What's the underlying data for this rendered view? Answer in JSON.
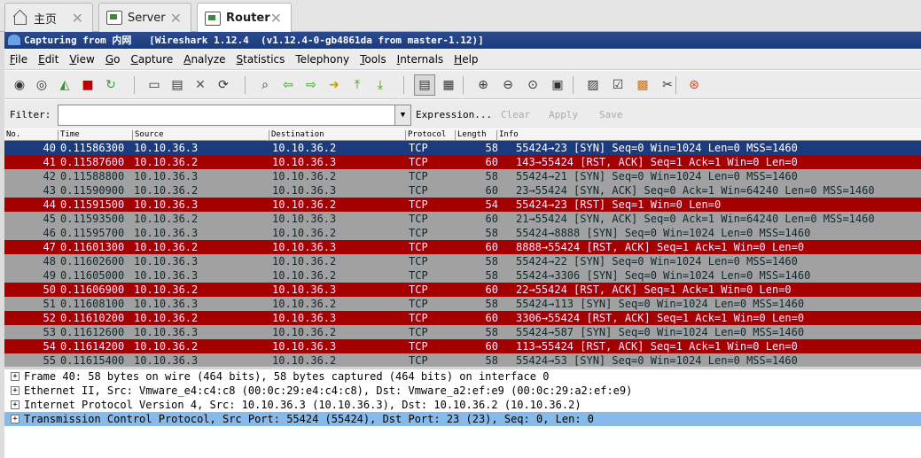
{
  "tabs": [
    {
      "label": "主页",
      "icon": "home-icon"
    },
    {
      "label": "Server",
      "icon": "vm-icon"
    },
    {
      "label": "Router",
      "icon": "vm-icon",
      "active": true
    }
  ],
  "window": {
    "title": "Capturing from 内网   [Wireshark 1.12.4  (v1.12.4-0-gb4861da from master-1.12)]"
  },
  "menu": [
    {
      "u": "F",
      "rest": "ile"
    },
    {
      "u": "E",
      "rest": "dit"
    },
    {
      "u": "V",
      "rest": "iew"
    },
    {
      "u": "G",
      "rest": "o"
    },
    {
      "u": "C",
      "rest": "apture"
    },
    {
      "u": "A",
      "rest": "nalyze"
    },
    {
      "u": "S",
      "rest": "tatistics"
    },
    {
      "u": "",
      "rest": "Telephony"
    },
    {
      "u": "T",
      "rest": "ools"
    },
    {
      "u": "I",
      "rest": "nternals"
    },
    {
      "u": "H",
      "rest": "elp"
    }
  ],
  "toolbar": {
    "icons": [
      "interface-list-icon",
      "capture-options-icon",
      "start-capture-icon",
      "stop-capture-icon",
      "restart-capture-icon",
      "open-file-icon",
      "save-file-icon",
      "close-file-icon",
      "reload-icon",
      "find-packet-icon",
      "go-back-icon",
      "go-forward-icon",
      "go-to-packet-icon",
      "go-first-icon",
      "go-last-icon",
      "colorize-icon",
      "auto-scroll-icon",
      "zoom-in-icon",
      "zoom-out-icon",
      "normal-size-icon",
      "resize-columns-icon",
      "capture-filters-icon",
      "display-filters-icon",
      "coloring-rules-icon",
      "preferences-icon",
      "help-icon"
    ]
  },
  "filter": {
    "label": "Filter:",
    "value": "",
    "expression": "Expression...",
    "clear": "Clear",
    "apply": "Apply",
    "save": "Save"
  },
  "columns": [
    "No.",
    "Time",
    "Source",
    "Destination",
    "Protocol",
    "Length",
    "Info"
  ],
  "packets": [
    {
      "no": "40",
      "time": "0.11586300",
      "src": "10.10.36.3",
      "dst": "10.10.36.2",
      "proto": "TCP",
      "len": "58",
      "info": "55424→23 [SYN] Seq=0 Win=1024 Len=0 MSS=1460",
      "color": "sel"
    },
    {
      "no": "41",
      "time": "0.11587600",
      "src": "10.10.36.2",
      "dst": "10.10.36.3",
      "proto": "TCP",
      "len": "60",
      "info": "143→55424 [RST, ACK] Seq=1 Ack=1 Win=0 Len=0",
      "color": "red"
    },
    {
      "no": "42",
      "time": "0.11588800",
      "src": "10.10.36.3",
      "dst": "10.10.36.2",
      "proto": "TCP",
      "len": "58",
      "info": "55424→21 [SYN] Seq=0 Win=1024 Len=0 MSS=1460",
      "color": "gray"
    },
    {
      "no": "43",
      "time": "0.11590900",
      "src": "10.10.36.2",
      "dst": "10.10.36.3",
      "proto": "TCP",
      "len": "60",
      "info": "23→55424 [SYN, ACK] Seq=0 Ack=1 Win=64240 Len=0 MSS=1460",
      "color": "gray"
    },
    {
      "no": "44",
      "time": "0.11591500",
      "src": "10.10.36.3",
      "dst": "10.10.36.2",
      "proto": "TCP",
      "len": "54",
      "info": "55424→23 [RST] Seq=1 Win=0 Len=0",
      "color": "red"
    },
    {
      "no": "45",
      "time": "0.11593500",
      "src": "10.10.36.2",
      "dst": "10.10.36.3",
      "proto": "TCP",
      "len": "60",
      "info": "21→55424 [SYN, ACK] Seq=0 Ack=1 Win=64240 Len=0 MSS=1460",
      "color": "gray"
    },
    {
      "no": "46",
      "time": "0.11595700",
      "src": "10.10.36.3",
      "dst": "10.10.36.2",
      "proto": "TCP",
      "len": "58",
      "info": "55424→8888 [SYN] Seq=0 Win=1024 Len=0 MSS=1460",
      "color": "gray"
    },
    {
      "no": "47",
      "time": "0.11601300",
      "src": "10.10.36.2",
      "dst": "10.10.36.3",
      "proto": "TCP",
      "len": "60",
      "info": "8888→55424 [RST, ACK] Seq=1 Ack=1 Win=0 Len=0",
      "color": "red"
    },
    {
      "no": "48",
      "time": "0.11602600",
      "src": "10.10.36.3",
      "dst": "10.10.36.2",
      "proto": "TCP",
      "len": "58",
      "info": "55424→22 [SYN] Seq=0 Win=1024 Len=0 MSS=1460",
      "color": "gray"
    },
    {
      "no": "49",
      "time": "0.11605000",
      "src": "10.10.36.3",
      "dst": "10.10.36.2",
      "proto": "TCP",
      "len": "58",
      "info": "55424→3306 [SYN] Seq=0 Win=1024 Len=0 MSS=1460",
      "color": "gray"
    },
    {
      "no": "50",
      "time": "0.11606900",
      "src": "10.10.36.2",
      "dst": "10.10.36.3",
      "proto": "TCP",
      "len": "60",
      "info": "22→55424 [RST, ACK] Seq=1 Ack=1 Win=0 Len=0",
      "color": "red"
    },
    {
      "no": "51",
      "time": "0.11608100",
      "src": "10.10.36.3",
      "dst": "10.10.36.2",
      "proto": "TCP",
      "len": "58",
      "info": "55424→113 [SYN] Seq=0 Win=1024 Len=0 MSS=1460",
      "color": "gray"
    },
    {
      "no": "52",
      "time": "0.11610200",
      "src": "10.10.36.2",
      "dst": "10.10.36.3",
      "proto": "TCP",
      "len": "60",
      "info": "3306→55424 [RST, ACK] Seq=1 Ack=1 Win=0 Len=0",
      "color": "red"
    },
    {
      "no": "53",
      "time": "0.11612600",
      "src": "10.10.36.3",
      "dst": "10.10.36.2",
      "proto": "TCP",
      "len": "58",
      "info": "55424→587 [SYN] Seq=0 Win=1024 Len=0 MSS=1460",
      "color": "gray"
    },
    {
      "no": "54",
      "time": "0.11614200",
      "src": "10.10.36.2",
      "dst": "10.10.36.3",
      "proto": "TCP",
      "len": "60",
      "info": "113→55424 [RST, ACK] Seq=1 Ack=1 Win=0 Len=0",
      "color": "red"
    },
    {
      "no": "55",
      "time": "0.11615400",
      "src": "10.10.36.3",
      "dst": "10.10.36.2",
      "proto": "TCP",
      "len": "58",
      "info": "55424→53 [SYN] Seq=0 Win=1024 Len=0 MSS=1460",
      "color": "gray"
    }
  ],
  "details": [
    {
      "text": "Frame 40: 58 bytes on wire (464 bits), 58 bytes captured (464 bits) on interface 0",
      "selected": false
    },
    {
      "text": "Ethernet II, Src: Vmware_e4:c4:c8 (00:0c:29:e4:c4:c8), Dst: Vmware_a2:ef:e9 (00:0c:29:a2:ef:e9)",
      "selected": false
    },
    {
      "text": "Internet Protocol Version 4, Src: 10.10.36.3 (10.10.36.3), Dst: 10.10.36.2 (10.10.36.2)",
      "selected": false
    },
    {
      "text": "Transmission Control Protocol, Src Port: 55424 (55424), Dst Port: 23 (23), Seq: 0, Len: 0",
      "selected": true
    }
  ],
  "colors": {
    "row_gray": "#a1a1a1",
    "row_red": "#a50000",
    "row_selected": "#1c3a7e",
    "detail_selected": "#86baeb",
    "title_bar": "#1c3a7e"
  }
}
